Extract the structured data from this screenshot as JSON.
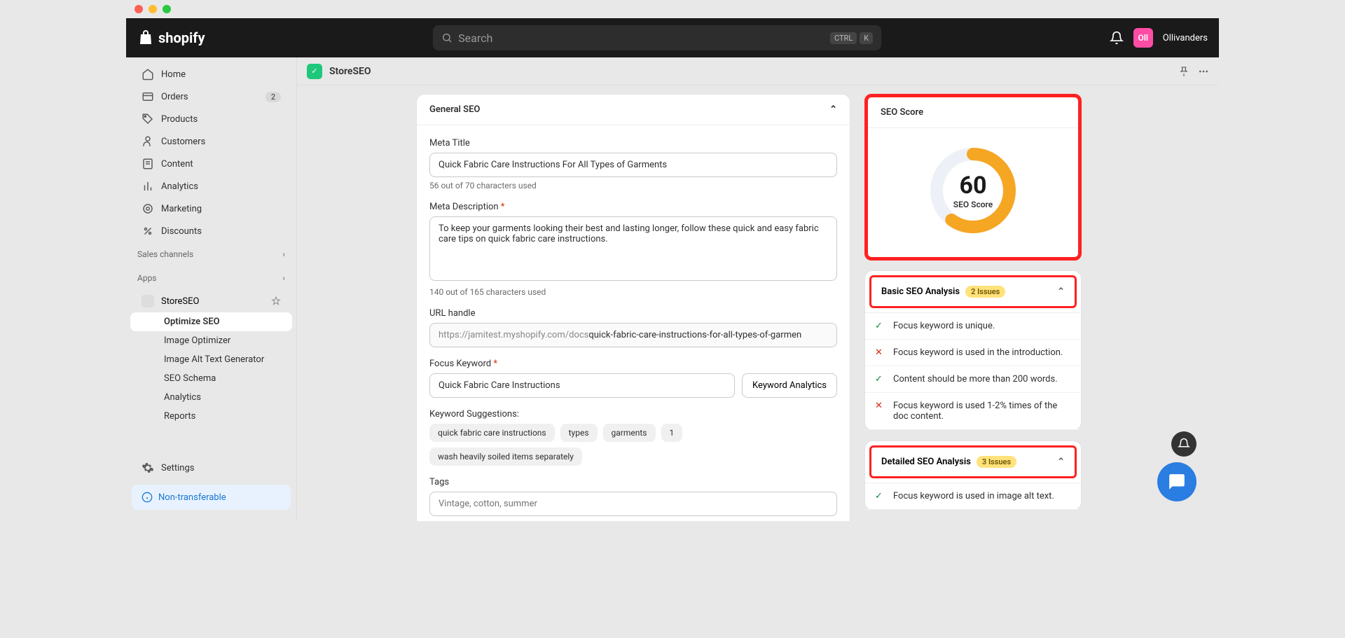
{
  "titlebar": {},
  "topbar": {
    "brand": "shopify",
    "search_placeholder": "Search",
    "kbd_ctrl": "CTRL",
    "kbd_k": "K",
    "user_initials": "Oll",
    "user_name": "Ollivanders"
  },
  "sidebar": {
    "nav": [
      {
        "label": "Home",
        "icon": "home"
      },
      {
        "label": "Orders",
        "icon": "orders",
        "badge": "2"
      },
      {
        "label": "Products",
        "icon": "tag"
      },
      {
        "label": "Customers",
        "icon": "person"
      },
      {
        "label": "Content",
        "icon": "content"
      },
      {
        "label": "Analytics",
        "icon": "analytics"
      },
      {
        "label": "Marketing",
        "icon": "marketing"
      },
      {
        "label": "Discounts",
        "icon": "discount"
      }
    ],
    "section_sales": "Sales channels",
    "section_apps": "Apps",
    "app_name": "StoreSEO",
    "subnav": [
      {
        "label": "Optimize SEO",
        "active": true
      },
      {
        "label": "Image Optimizer"
      },
      {
        "label": "Image Alt Text Generator"
      },
      {
        "label": "SEO Schema"
      },
      {
        "label": "Analytics"
      },
      {
        "label": "Reports"
      }
    ],
    "settings": "Settings",
    "non_transferable": "Non-transferable"
  },
  "app_header": {
    "title": "StoreSEO"
  },
  "general_seo": {
    "title": "General SEO",
    "meta_title_label": "Meta Title",
    "meta_title_value": "Quick Fabric Care Instructions For All Types of Garments",
    "meta_title_helper": "56 out of 70 characters used",
    "meta_desc_label": "Meta Description ",
    "meta_desc_value": "To keep your garments looking their best and lasting longer, follow these quick and easy fabric care tips on quick fabric care instructions.",
    "meta_desc_helper": "140 out of 165 characters used",
    "url_label": "URL handle",
    "url_prefix": "https://jamitest.myshopify.com/docs ",
    "url_value": "quick-fabric-care-instructions-for-all-types-of-garmen",
    "focus_label": "Focus Keyword ",
    "focus_value": "Quick Fabric Care Instructions",
    "keyword_analytics_btn": "Keyword Analytics",
    "suggestions_label": "Keyword Suggestions:",
    "suggestions": [
      "quick fabric care instructions",
      "types",
      "garments",
      "1",
      "wash heavily soiled items separately"
    ],
    "tags_label": "Tags",
    "tags_placeholder": "Vintage, cotton, summer"
  },
  "seo_score": {
    "title": "SEO Score",
    "value": "60",
    "label": "SEO Score"
  },
  "basic_analysis": {
    "title": "Basic SEO Analysis",
    "issues_badge": "2 Issues",
    "items": [
      {
        "ok": true,
        "text": "Focus keyword is unique."
      },
      {
        "ok": false,
        "text": "Focus keyword is used in the introduction."
      },
      {
        "ok": true,
        "text": "Content should be more than 200 words."
      },
      {
        "ok": false,
        "text": "Focus keyword is used 1-2% times of the doc content."
      }
    ]
  },
  "detailed_analysis": {
    "title": "Detailed SEO Analysis",
    "issues_badge": "3 Issues",
    "items": [
      {
        "ok": true,
        "text": "Focus keyword is used in image alt text."
      }
    ]
  }
}
